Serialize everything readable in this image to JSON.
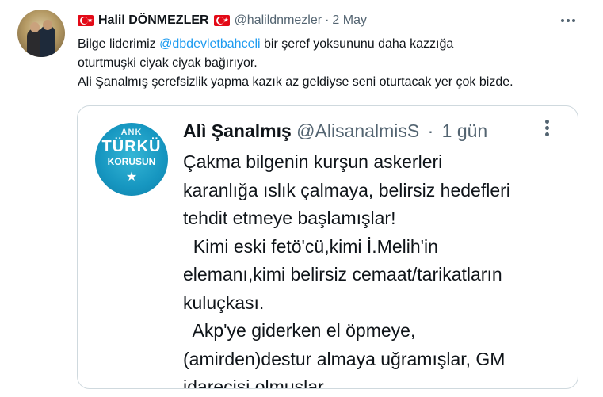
{
  "tweet": {
    "author_name": "Halil DÖNMEZLER",
    "author_handle": "@halildnmezler",
    "separator": "·",
    "date": "2 May",
    "more_icon": "more-horizontal-icon",
    "text_lines": [
      {
        "before": "Bilge liderimiz ",
        "mention": "@dbdevletbahceli",
        "after": " bir şeref yoksununu daha kazzığa"
      },
      {
        "text": "oturtmuşki ciyak ciyak bağırıyor."
      },
      {
        "text": "Ali Şanalmış şerefsizlik yapma kazık az geldiyse seni oturtacak yer çok bizde."
      }
    ],
    "colors": {
      "link": "#1d9bf0",
      "secondary": "#536471",
      "border": "#cfd9de",
      "flag_red": "#e30a17"
    }
  },
  "quoted": {
    "author_name": "Alì Şanalmış",
    "author_handle": "@AlisanalmisS",
    "separator": "·",
    "date": "1 gün",
    "avatar_text": {
      "top": "ANK",
      "main": "TÜRKÜ",
      "sub": "KORUSUN",
      "star": "★"
    },
    "text_lines": [
      "Çakma bilgenin kurşun askerleri",
      "karanlığa ıslık çalmaya, belirsiz hedefleri",
      "tehdit etmeye başlamışlar!",
      "  Kimi eski fetö'cü,kimi İ.Melih'in",
      "elemanı,kimi belirsiz cemaat/tarikatların",
      "kuluçkası.",
      "  Akp'ye giderken el öpmeye,",
      "(amirden)destur almaya uğramışlar, GM",
      "idarecisi olmuşlar."
    ]
  }
}
